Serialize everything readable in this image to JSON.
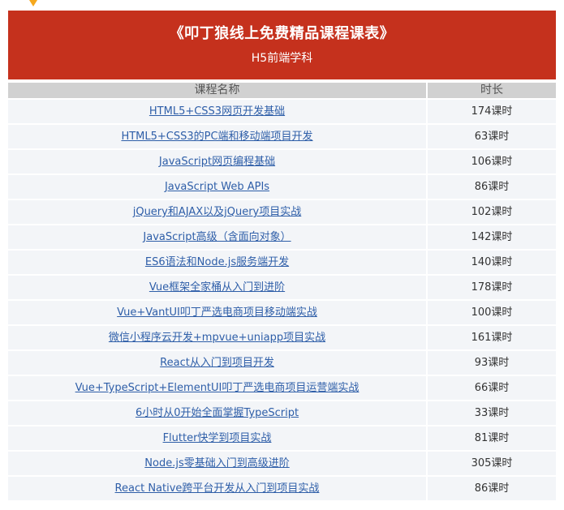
{
  "header": {
    "title": "《叩丁狼线上免费精品课程课表》",
    "subtitle": "H5前端学科"
  },
  "columns": {
    "course": "课程名称",
    "duration": "时长"
  },
  "courses": [
    {
      "name": "HTML5+CSS3网页开发基础",
      "hours": "174课时"
    },
    {
      "name": "HTML5+CSS3的PC端和移动端项目开发",
      "hours": "63课时"
    },
    {
      "name": "JavaScript网页编程基础",
      "hours": "106课时"
    },
    {
      "name": "JavaScript Web APIs",
      "hours": "86课时"
    },
    {
      "name": "jQuery和AJAX以及jQuery项目实战",
      "hours": "102课时"
    },
    {
      "name": "JavaScript高级（含面向对象）",
      "hours": "142课时"
    },
    {
      "name": "ES6语法和Node.js服务端开发",
      "hours": "140课时"
    },
    {
      "name": "Vue框架全家桶从入门到进阶",
      "hours": "178课时"
    },
    {
      "name": "Vue+VantUI叩丁严选电商项目移动端实战",
      "hours": "100课时"
    },
    {
      "name": "微信小程序云开发+mpvue+uniapp项目实战",
      "hours": "161课时"
    },
    {
      "name": "React从入门到项目开发",
      "hours": "93课时"
    },
    {
      "name": "Vue+TypeScript+ElementUI叩丁严选电商项目运营端实战",
      "hours": "66课时"
    },
    {
      "name": "6小时从0开始全面掌握TypeScript",
      "hours": "33课时"
    },
    {
      "name": "Flutter快学到项目实战",
      "hours": "81课时"
    },
    {
      "name": "Node.js零基础入门到高级进阶",
      "hours": "305课时"
    },
    {
      "name": "React Native跨平台开发从入门到项目实战",
      "hours": "86课时"
    }
  ],
  "colors": {
    "banner": "#c5311d",
    "link": "#2e5ea8",
    "header_row": "#d1d1d1",
    "row": "#f3f5f8",
    "accent": "#f5a81e"
  }
}
